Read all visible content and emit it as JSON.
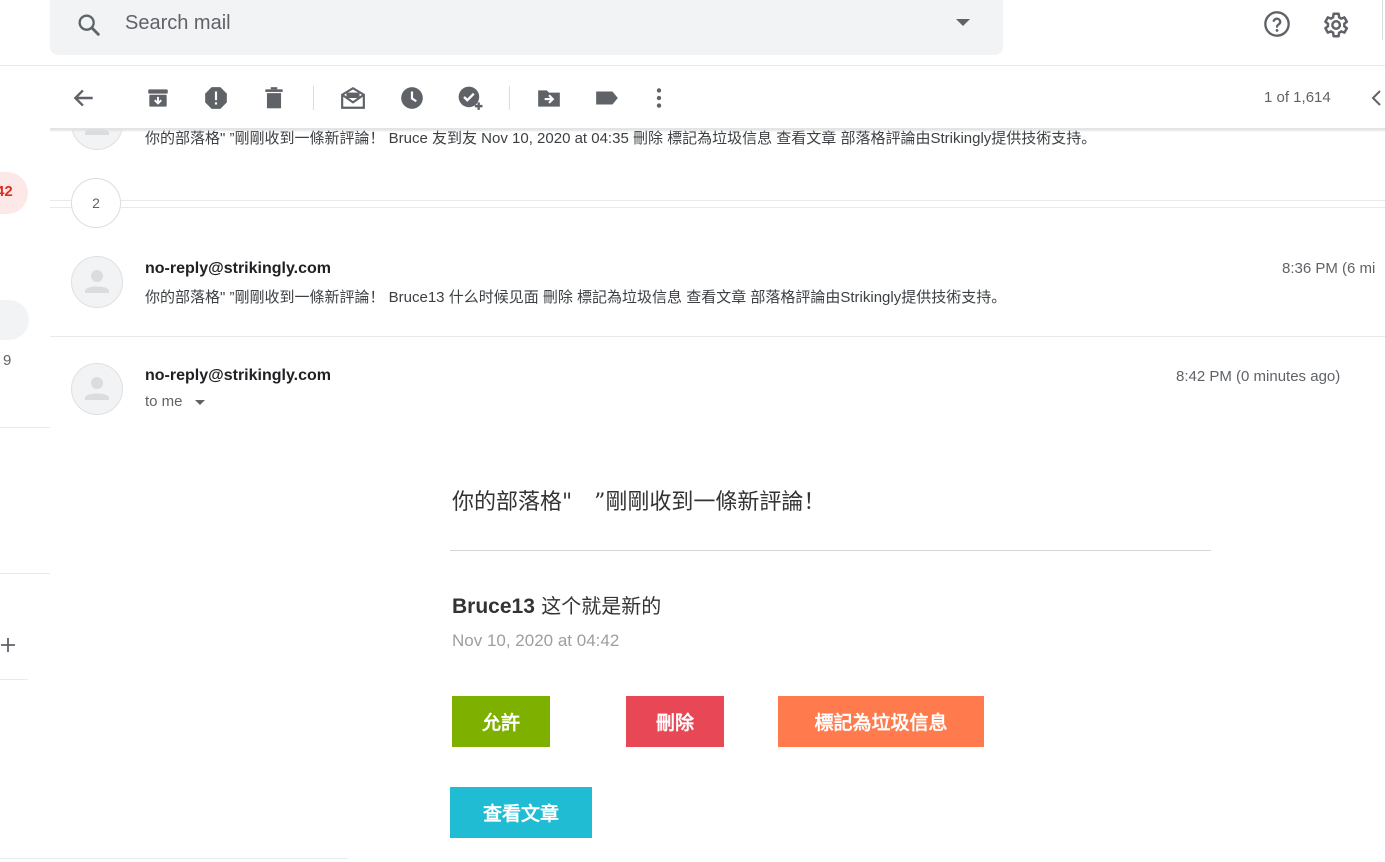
{
  "search": {
    "placeholder": "Search mail"
  },
  "header_icons": [
    "search-icon",
    "chevron-down-icon",
    "help-icon",
    "gear-icon"
  ],
  "toolbar": {
    "icons": [
      "back-arrow-icon",
      "archive-icon",
      "report-spam-icon",
      "delete-icon",
      "mark-unread-icon",
      "snooze-icon",
      "add-to-tasks-icon",
      "move-to-icon",
      "label-icon",
      "more-vert-icon"
    ],
    "page_count": "1 of 1,614"
  },
  "left_rail": {
    "badge": "42",
    "count": "9"
  },
  "thread": {
    "top_snippet": "你的部落格\" ”剛剛收到一條新評論！ Bruce 友到友 Nov 10, 2020 at 04:35 刪除 標記為垃圾信息 查看文章 部落格評論由Strikingly提供技術支持。",
    "collapsed_count": "2",
    "message_2": {
      "sender": "no-reply@strikingly.com",
      "time": "8:36 PM (6 mi",
      "snippet": "你的部落格\" ”剛剛收到一條新評論！ Bruce13 什么时候见面 刪除 標記為垃圾信息 查看文章 部落格評論由Strikingly提供技術支持。"
    },
    "message_3": {
      "sender": "no-reply@strikingly.com",
      "time": "8:42 PM (0 minutes ago)",
      "to": "to me"
    }
  },
  "email_body": {
    "heading": "你的部落格\"　”剛剛收到一條新評論！",
    "commenter_name": "Bruce13",
    "comment_text": " 这个就是新的",
    "comment_date": "Nov 10, 2020 at 04:42",
    "buttons": {
      "approve": "允許",
      "delete": "刪除",
      "spam": "標記為垃圾信息",
      "view": "查看文章"
    }
  },
  "colors": {
    "approve": "#7eb000",
    "delete": "#e84756",
    "spam": "#ff7a4d",
    "view": "#20bcd3",
    "badge": "#d93025"
  }
}
